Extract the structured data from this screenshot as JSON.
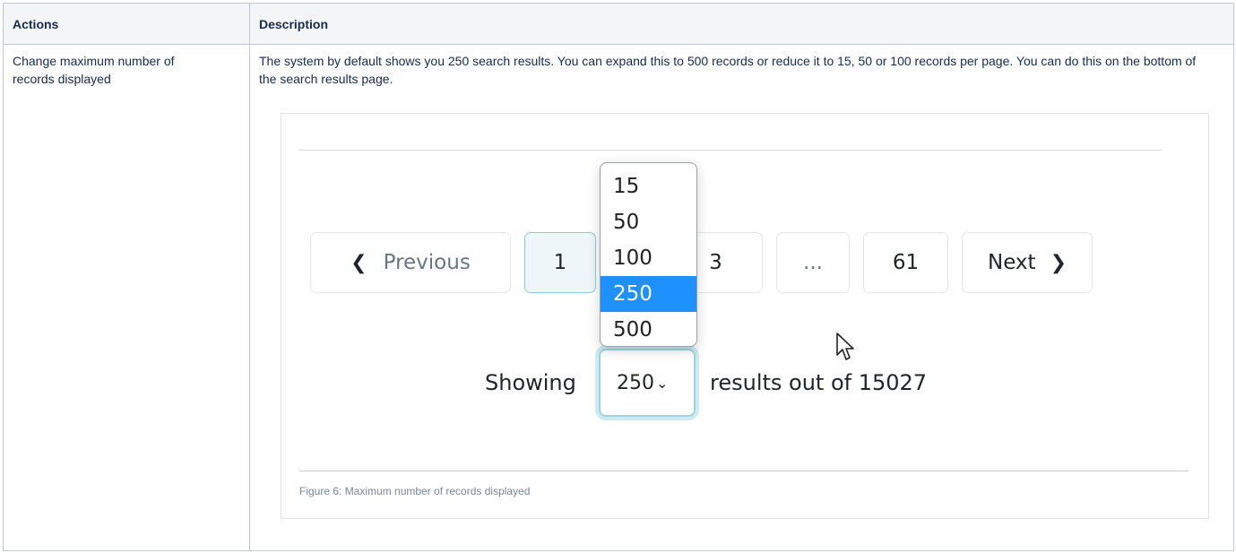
{
  "table": {
    "headers": [
      "Actions",
      "Description"
    ],
    "rows": [
      {
        "action": "Change maximum number of records displayed",
        "description": "The system by default shows you 250 search results. You can expand this to 500 records or reduce it to 15, 50 or 100 records per page. You can do this on the bottom of the search results page."
      }
    ]
  },
  "figure": {
    "pagination": {
      "previous_label": "Previous",
      "next_label": "Next",
      "pages": [
        "1",
        "3",
        "...",
        "61"
      ],
      "current_page": "1"
    },
    "showing_label": "Showing",
    "selected_value": "250",
    "results_label": "results out of 15027",
    "options": [
      "15",
      "50",
      "100",
      "250",
      "500"
    ],
    "selected_option": "250",
    "caption": "Figure 6: Maximum number of records displayed",
    "colors": {
      "highlight": "#1e90ff",
      "active_page_border": "#8ccbdc",
      "table_header_bg": "#f4f5f7"
    },
    "icons": [
      "chevron-left-icon",
      "chevron-right-icon",
      "chevron-down-icon",
      "mouse-pointer-icon"
    ]
  }
}
